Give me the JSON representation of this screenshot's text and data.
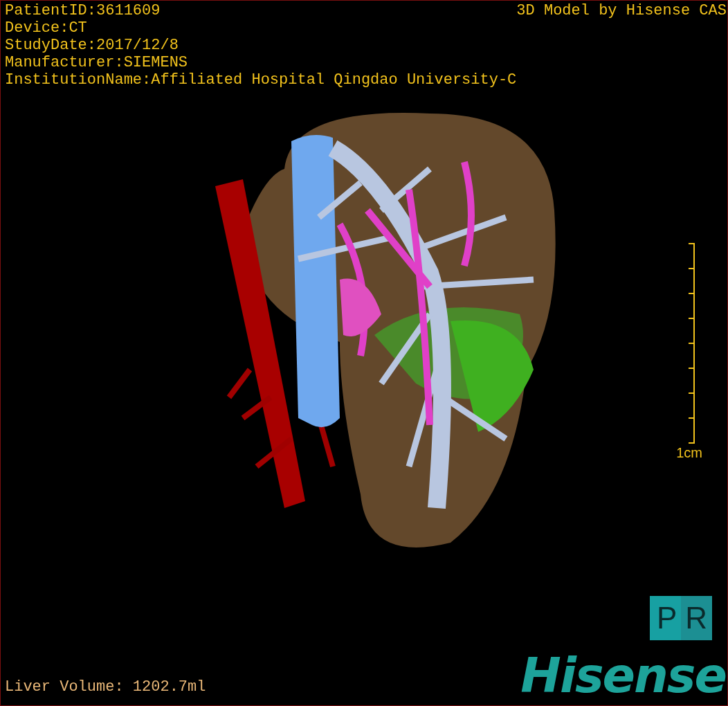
{
  "info_lines": [
    "PatientID:3611609",
    "Device:CT",
    "StudyDate:2017/12/8",
    "Manufacturer:SIEMENS",
    "InstitutionName:Affiliated Hospital Qingdao University-C"
  ],
  "title": "3D Model by Hisense CAS",
  "scale_bar": {
    "label": "1cm"
  },
  "liver_volume": "Liver Volume: 1202.7ml",
  "pr_button": {
    "label": "PR"
  },
  "logo": "Hisense"
}
